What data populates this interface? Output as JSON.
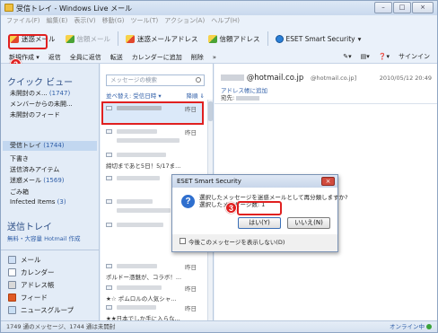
{
  "window": {
    "title": "受信トレイ - Windows Live メール",
    "controls": [
      "–",
      "□",
      "×"
    ]
  },
  "menu": [
    "ファイル(F)",
    "編集(E)",
    "表示(V)",
    "移動(G)",
    "ツール(T)",
    "アクション(A)",
    "ヘルプ(H)"
  ],
  "toolbar1": {
    "spam": "迷惑メール",
    "trust": "信頼メール",
    "spam_address": "迷惑メールアドレス",
    "trust_address": "信頼アドレス",
    "eset": "ESET Smart Security"
  },
  "toolbar2": {
    "items": [
      "新規作成 ▾",
      "返信",
      "全員に返信",
      "転送",
      "カレンダーに追加",
      "削除",
      "»"
    ],
    "signin": "サインイン"
  },
  "badges": {
    "one": "1",
    "two": "2",
    "three": "3"
  },
  "quick_views": {
    "title": "クイック ビュー",
    "items": [
      {
        "label": "未開封のメ...",
        "count": "(1747)"
      },
      {
        "label": "メンバーからの未開...",
        "count": ""
      },
      {
        "label": "未開封のフィード",
        "count": ""
      }
    ]
  },
  "folders": [
    {
      "label": "受信トレイ",
      "count": "(1744)"
    },
    {
      "label": "下書き",
      "count": ""
    },
    {
      "label": "送信済みアイテム",
      "count": ""
    },
    {
      "label": "迷惑メール",
      "count": "(1569)"
    },
    {
      "label": "ごみ箱",
      "count": ""
    },
    {
      "label": "Infected Items",
      "count": "(3)"
    }
  ],
  "account": {
    "title": "送信トレイ",
    "sub": "無料・大容量 Hotmail 作成"
  },
  "modules": [
    "メール",
    "カレンダー",
    "アドレス帳",
    "フィード",
    "ニュースグループ"
  ],
  "list": {
    "search_placeholder": "メッセージの検索",
    "sort_left": "並べ替え: 受信日時 ▾",
    "sort_right": "降順 ⇓",
    "messages": [
      {
        "date": "昨日",
        "subject": ""
      },
      {
        "date": "昨日",
        "subject": ""
      },
      {
        "date": "",
        "subject": "締切まであと5日！5/17ま..."
      },
      {
        "date": "昨日",
        "subject": ""
      },
      {
        "date": "",
        "subject": ""
      },
      {
        "date": "昨日",
        "subject": ""
      },
      {
        "date": "昨日",
        "subject": "ポルドー憑魅が、コラボ！..."
      },
      {
        "date": "昨日",
        "subject": "★☆ ポムロルの人気シャ..."
      },
      {
        "date": "昨日",
        "subject": "★★日本でしか手に入らな..."
      }
    ]
  },
  "reading": {
    "from": "@hotmail.co.jp",
    "from_addr": "@hotmail.co.jp]",
    "date": "2010/05/12 20:49",
    "add_contact": "アドレス帳に追加",
    "to_label": "宛先:"
  },
  "dialog": {
    "title": "ESET Smart Security",
    "close": "×",
    "message_line1": "選択したメッセージを迷惑メールとして再分類しますか?",
    "message_line2": "選択したメッセージ数: 1",
    "yes": "はい(Y)",
    "no": "いいえ(N)",
    "checkbox_label": "今後このメッセージを表示しない(D)"
  },
  "status": {
    "left": "1749 通のメッセージ、1744 通は未開封",
    "right": "オンライン中"
  }
}
